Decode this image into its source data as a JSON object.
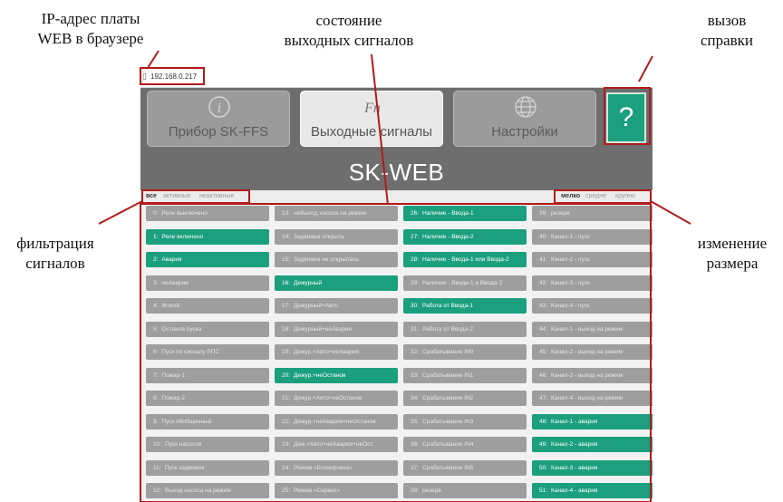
{
  "annotations": {
    "ip_address": "IP-адрес платы\nWEB в браузере",
    "output_state": "состояние\nвыходных сигналов",
    "help_call": "вызов\nсправки",
    "filtering": "фильтрация\nсигналов",
    "resize": "изменение\nразмера"
  },
  "browser": {
    "url": "192.168.0.217",
    "page_icon": "page-icon"
  },
  "nav": {
    "device": {
      "label": "Прибор SK-FFS",
      "icon": "info-icon"
    },
    "outputs": {
      "label": "Выходные сигналы",
      "icon": "fn-icon",
      "glyph": "Fn"
    },
    "settings": {
      "label": "Настройки",
      "icon": "globe-icon"
    },
    "help": {
      "label": "?"
    }
  },
  "app_title": "SK-WEB",
  "filters": {
    "all": "все",
    "active": "активные",
    "inactive": "неактивные",
    "selected": "все"
  },
  "sizes": {
    "small": "мелко",
    "medium": "средне",
    "large": "крупно",
    "selected": "мелко"
  },
  "colors": {
    "active": "#1b9f7e",
    "inactive": "#9e9e9e",
    "header": "#6e6e6e"
  },
  "signals": [
    [
      {
        "num": "0:",
        "text": "Реле выключено",
        "active": false
      },
      {
        "num": "1:",
        "text": "Реле включено",
        "active": true
      },
      {
        "num": "2:",
        "text": "Авария",
        "active": true
      },
      {
        "num": "3:",
        "text": "неАвария",
        "active": false
      },
      {
        "num": "4:",
        "text": "Жокей",
        "active": false
      },
      {
        "num": "5:",
        "text": "Останов пуска",
        "active": false
      },
      {
        "num": "6:",
        "text": "Пуск по сигналу РПС",
        "active": false
      },
      {
        "num": "7:",
        "text": "Пожар-1",
        "active": false
      },
      {
        "num": "8:",
        "text": "Пожар-2",
        "active": false
      },
      {
        "num": "9:",
        "text": "Пуск обобщенный",
        "active": false
      },
      {
        "num": "10:",
        "text": "Пуск насосов",
        "active": false
      },
      {
        "num": "11:",
        "text": "Пуск задвижек",
        "active": false
      },
      {
        "num": "12:",
        "text": "Выход насоса на режим",
        "active": false
      }
    ],
    [
      {
        "num": "13:",
        "text": "неВыход насоса на режим",
        "active": false
      },
      {
        "num": "14:",
        "text": "Задвижка открыта",
        "active": false
      },
      {
        "num": "15:",
        "text": "Задвижка не открылась",
        "active": false
      },
      {
        "num": "16:",
        "text": "Дежурный",
        "active": true
      },
      {
        "num": "17:",
        "text": "Дежурный+Авто",
        "active": false
      },
      {
        "num": "18:",
        "text": "Дежурный+неАвария",
        "active": false
      },
      {
        "num": "19:",
        "text": "Дежур.+Авто+неАвария",
        "active": false
      },
      {
        "num": "20:",
        "text": "Дежур.+неОстанов",
        "active": true
      },
      {
        "num": "21:",
        "text": "Дежур.+Авто+неОстанов",
        "active": false
      },
      {
        "num": "22:",
        "text": "Дежур.+неАвария+неОстанов",
        "active": false
      },
      {
        "num": "23:",
        "text": "Деж.+Авто+неАвария+неОст.",
        "active": false
      },
      {
        "num": "24:",
        "text": "Режим «Блокировка»",
        "active": false
      },
      {
        "num": "25:",
        "text": "Режим «Сервис»",
        "active": false
      }
    ],
    [
      {
        "num": "26:",
        "text": "Наличие - Ввода-1",
        "active": true
      },
      {
        "num": "27:",
        "text": "Наличие - Ввода-2",
        "active": true
      },
      {
        "num": "28:",
        "text": "Наличие - Ввода-1 или Ввода-2",
        "active": true
      },
      {
        "num": "29:",
        "text": "Наличие - Ввода-1 и Ввода-2",
        "active": false
      },
      {
        "num": "30:",
        "text": "Работа от Ввода-1",
        "active": true
      },
      {
        "num": "31:",
        "text": "Работа от Ввода-2",
        "active": false
      },
      {
        "num": "32:",
        "text": "Срабатывание IN0",
        "active": false
      },
      {
        "num": "33:",
        "text": "Срабатывание IN1",
        "active": false
      },
      {
        "num": "34:",
        "text": "Срабатывание IN2",
        "active": false
      },
      {
        "num": "35:",
        "text": "Срабатывание IN3",
        "active": false
      },
      {
        "num": "36:",
        "text": "Срабатывание IN4",
        "active": false
      },
      {
        "num": "37:",
        "text": "Срабатывание IN5",
        "active": false
      },
      {
        "num": "38:",
        "text": "резерв",
        "active": false
      }
    ],
    [
      {
        "num": "39:",
        "text": "резерв",
        "active": false
      },
      {
        "num": "40:",
        "text": "Канал-1 - пуск",
        "active": false
      },
      {
        "num": "41:",
        "text": "Канал-2 - пуск",
        "active": false
      },
      {
        "num": "42:",
        "text": "Канал-3 - пуск",
        "active": false
      },
      {
        "num": "43:",
        "text": "Канал-4 - пуск",
        "active": false
      },
      {
        "num": "44:",
        "text": "Канал-1 - выход на режим",
        "active": false
      },
      {
        "num": "45:",
        "text": "Канал-2 - выход на режим",
        "active": false
      },
      {
        "num": "46:",
        "text": "Канал-3 - выход на режим",
        "active": false
      },
      {
        "num": "47:",
        "text": "Канал-4 - выход на режим",
        "active": false
      },
      {
        "num": "48:",
        "text": "Канал-1 - авария",
        "active": true
      },
      {
        "num": "49:",
        "text": "Канал-2 - авария",
        "active": true
      },
      {
        "num": "50:",
        "text": "Канал-3 - авария",
        "active": true
      },
      {
        "num": "51:",
        "text": "Канал-4 - авария",
        "active": true
      }
    ]
  ]
}
